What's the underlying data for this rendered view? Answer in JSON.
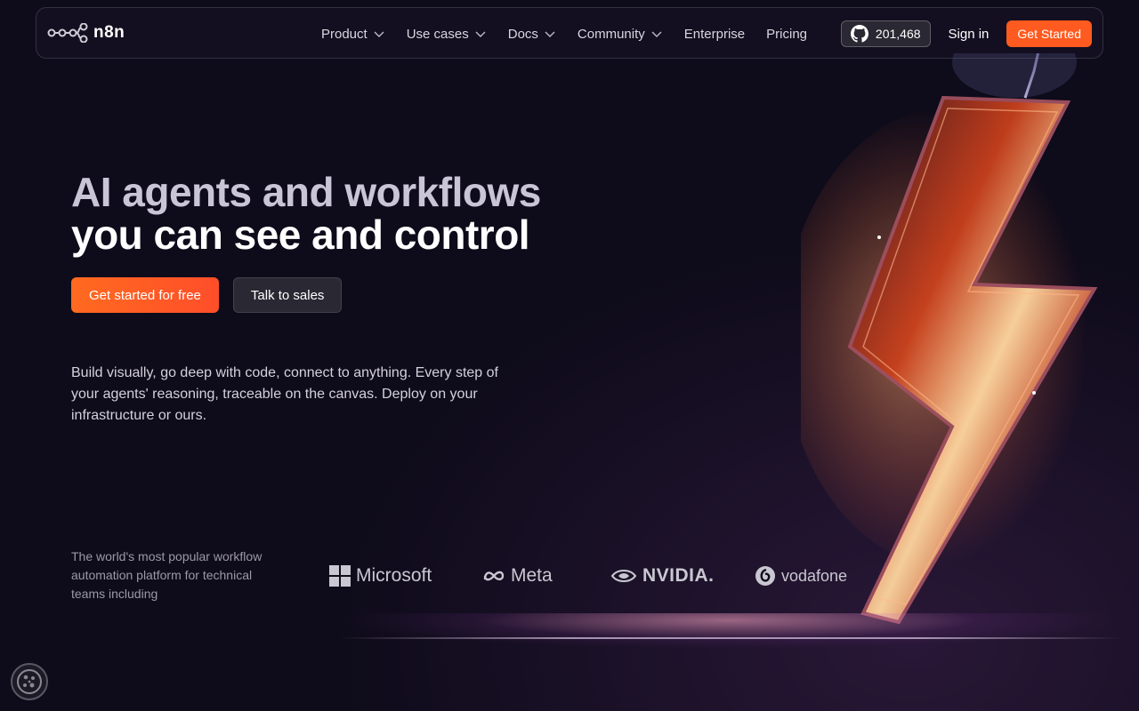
{
  "brand": {
    "name": "n8n",
    "accent": "#ff5a1f"
  },
  "nav": {
    "links": [
      {
        "label": "Product",
        "has_dropdown": true
      },
      {
        "label": "Use cases",
        "has_dropdown": true
      },
      {
        "label": "Docs",
        "has_dropdown": true
      },
      {
        "label": "Community",
        "has_dropdown": true
      },
      {
        "label": "Enterprise",
        "has_dropdown": false
      },
      {
        "label": "Pricing",
        "has_dropdown": false
      }
    ],
    "github_stars": "201,468",
    "github_icon": "github-icon",
    "signin_label": "Sign in",
    "get_started_label": "Get Started"
  },
  "hero": {
    "title_line1": "AI agents and workflows",
    "title_line2": "you can see and control",
    "primary_cta": "Get started for free",
    "secondary_cta": "Talk to sales",
    "description": "Build visually, go deep with code, connect to anything. Every step of your agents' reasoning, traceable on the canvas. Deploy on your infrastructure or ours."
  },
  "trust": {
    "text": "The world's most popular workflow automation platform for technical teams including",
    "logos": [
      {
        "name": "Microsoft",
        "icon": "microsoft-logo"
      },
      {
        "name": "Meta",
        "icon": "meta-logo"
      },
      {
        "name": "NVIDIA.",
        "icon": "nvidia-logo"
      },
      {
        "name": "vodafone",
        "icon": "vodafone-logo"
      }
    ]
  },
  "cookie_icon": "cookie-icon"
}
